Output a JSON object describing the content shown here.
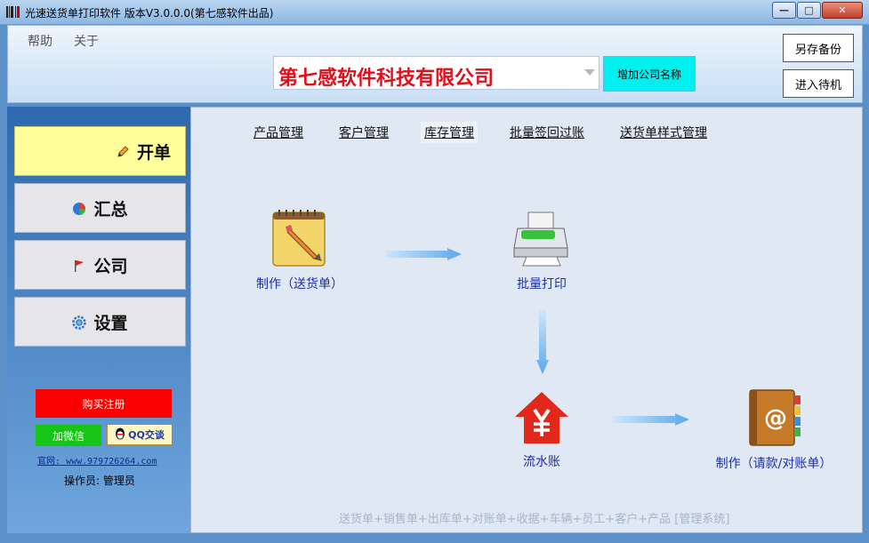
{
  "window": {
    "title": "光速送货单打印软件 版本V3.0.0.0(第七感软件出品)",
    "minimize": "—",
    "maximize": "□",
    "close": "✕"
  },
  "menu": [
    "帮助",
    "关于"
  ],
  "header": {
    "company_name": "第七感软件科技有限公司",
    "add_company": "增加公司名称",
    "save_backup": "另存备份",
    "standby": "进入待机"
  },
  "sidebar": {
    "items": [
      {
        "label": "开单",
        "icon": "pencil-icon",
        "active": true
      },
      {
        "label": "汇总",
        "icon": "pie-chart-icon",
        "active": false
      },
      {
        "label": "公司",
        "icon": "flag-icon",
        "active": false
      },
      {
        "label": "设置",
        "icon": "gear-icon",
        "active": false
      }
    ],
    "buy_register": "购买注册",
    "add_wechat": "加微信",
    "qq_chat": "QQ交谈",
    "website_label": "官网:",
    "website_url": "www.979726264.com",
    "operator": "操作员: 管理员"
  },
  "topnav": [
    "产品管理",
    "客户管理",
    "库存管理",
    "批量签回过账",
    "送货单样式管理"
  ],
  "flow": {
    "make": "制作（送货单）",
    "batch_print": "批量打印",
    "ledger": "流水账",
    "make_invoice": "制作（请款/对账单）"
  },
  "footer": "送货单+销售单+出库单+对账单+收据+车辆+员工+客户+产品 [管理系统]",
  "colors": {
    "company_red": "#e0101b",
    "add_company_bg": "#00f0f0",
    "active_nav": "#ffff9c",
    "buy_red": "#fa0000",
    "wechat_green": "#16c416",
    "link_blue": "#1d2ea8"
  }
}
